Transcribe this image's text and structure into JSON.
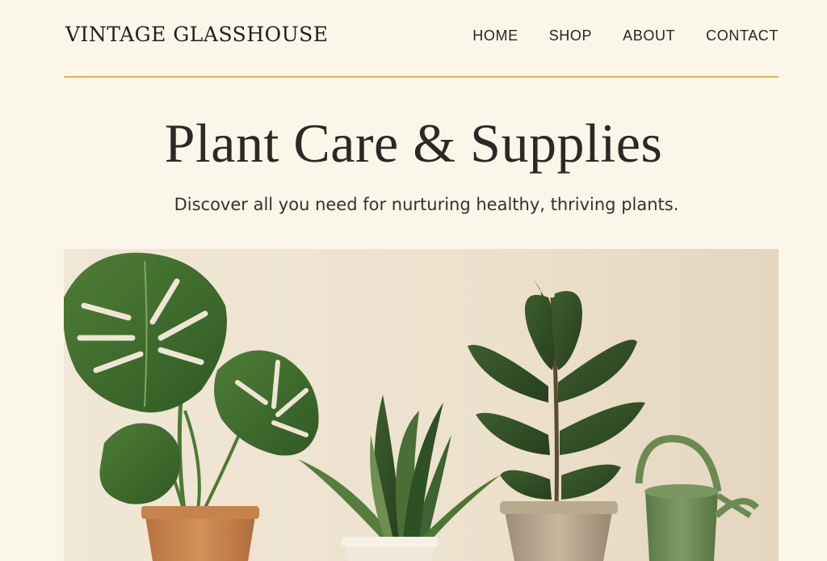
{
  "brand": {
    "name": "VINTAGE GLASSHOUSE"
  },
  "nav": {
    "items": [
      {
        "label": "HOME"
      },
      {
        "label": "SHOP"
      },
      {
        "label": "ABOUT"
      },
      {
        "label": "CONTACT"
      }
    ]
  },
  "hero": {
    "title": "Plant Care & Supplies",
    "subtitle": "Discover all you need for nurturing healthy, thriving plants."
  },
  "colors": {
    "background": "#fbf6ea",
    "accent_rule": "#e4b14f",
    "text": "#2a2926",
    "leaf_green": "#3f6a2e",
    "terracotta": "#c98a4f"
  }
}
